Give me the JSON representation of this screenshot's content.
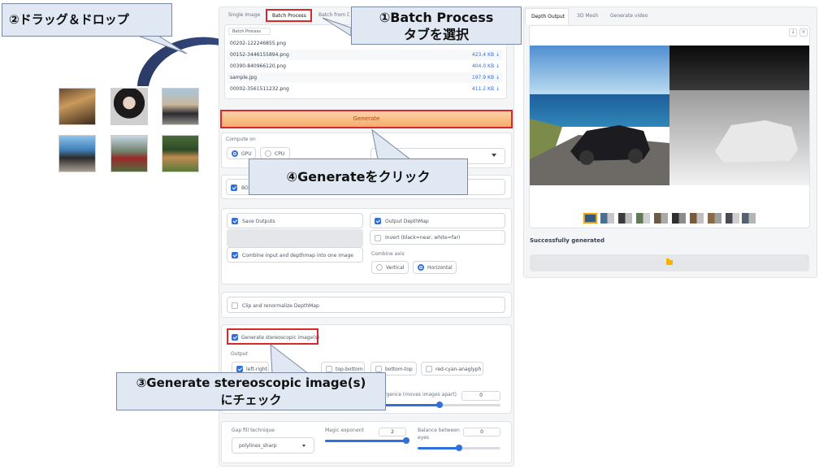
{
  "tabs": {
    "single_image": "Single Image",
    "batch_process": "Batch Process",
    "batch_from_directory": "Batch from Directory"
  },
  "batch": {
    "header": "Batch Process",
    "files": [
      {
        "name": "00202-122246855.png",
        "size": ""
      },
      {
        "name": "00152-3446155894.png",
        "size": "423.4 KB ↓"
      },
      {
        "name": "00390-840966120.png",
        "size": "404.0 KB ↓"
      },
      {
        "name": "sample.jpg",
        "size": "197.9 KB ↓"
      },
      {
        "name": "00002-3561511232.png",
        "size": "411.2 KB ↓"
      }
    ]
  },
  "generate_label": "Generate",
  "compute": {
    "label": "Compute on",
    "gpu": "GPU",
    "cpu": "CPU",
    "selected": "GPU"
  },
  "boost_label": "BOOST",
  "outputs": {
    "save_outputs": "Save Outputs",
    "output_depthmap": "Output DepthMap",
    "invert": "Invert (black=near, white=far)",
    "combine": "Combine input and depthmap into one image",
    "combine_axis_label": "Combine axis",
    "vertical": "Vertical",
    "horizontal": "Horizontal",
    "combine_axis_selected": "Horizontal"
  },
  "clip_label": "Clip and renormalize DepthMap",
  "stereo": {
    "generate_label": "Generate stereoscopic image(s)",
    "output_label": "Output",
    "left_right": "left-right",
    "top_bottom": "top-bottom",
    "bottom_top": "bottom-top",
    "anaglyph": "red-cyan-anaglyph",
    "divergence_label": "Divergence (moves images apart)",
    "divergence_value": "0",
    "gap_fill_label": "Gap fill technique",
    "gap_fill_value": "polylines_sharp",
    "magic_label": "Magic exponent",
    "magic_value": "2",
    "balance_label": "Balance between eyes",
    "balance_value": "0",
    "magic_slider": 1.0,
    "balance_slider": 0.5
  },
  "right_panel": {
    "tabs": [
      "Depth Output",
      "3D Mesh",
      "Generate video"
    ],
    "status": "Successfully generated",
    "folder_icon": "folder-icon",
    "corner_icons": [
      "download-icon",
      "close-icon"
    ]
  },
  "annotations": {
    "step1_line1": "①Batch Process",
    "step1_line2": "タブを選択",
    "step2": "②ドラッグ＆ドロップ",
    "step3_line1": "③Generate stereoscopic image(s)",
    "step3_line2": "にチェック",
    "step4": "④Generateをクリック"
  },
  "colors": {
    "accent": "#2f6fde",
    "generate_bg": "#f8b77c",
    "highlight_red": "#d8282a",
    "callout_bg": "#dfe8f3"
  }
}
